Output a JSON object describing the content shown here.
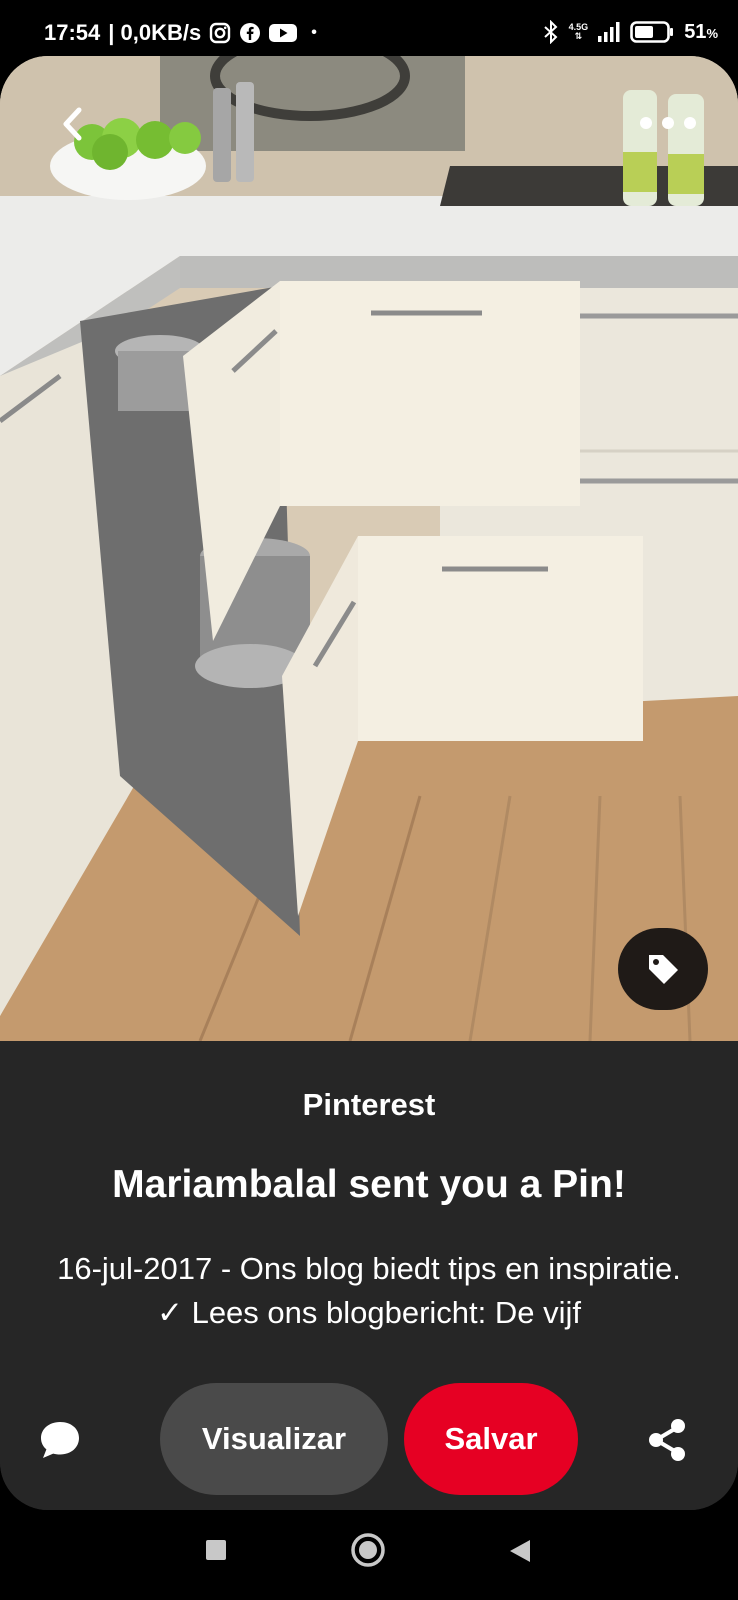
{
  "status_bar": {
    "time": "17:54",
    "speed": "| 0,0KB/s",
    "dot": "•",
    "network_type": "4.5G",
    "battery": "51",
    "battery_unit": "%",
    "icons": [
      "instagram-icon",
      "facebook-icon",
      "youtube-icon",
      "bluetooth-icon",
      "signal-icon",
      "battery-icon"
    ]
  },
  "pin": {
    "source": "Pinterest",
    "title": "Mariambalal sent you a Pin!",
    "description": "16-jul-2017 - Ons blog biedt tips en inspiratie. ✓ Lees ons blogbericht: De vijf"
  },
  "actions": {
    "visit_label": "Visualizar",
    "save_label": "Salvar"
  },
  "colors": {
    "save": "#e60023",
    "visit": "#4a4a4a",
    "sheet": "#262626"
  }
}
